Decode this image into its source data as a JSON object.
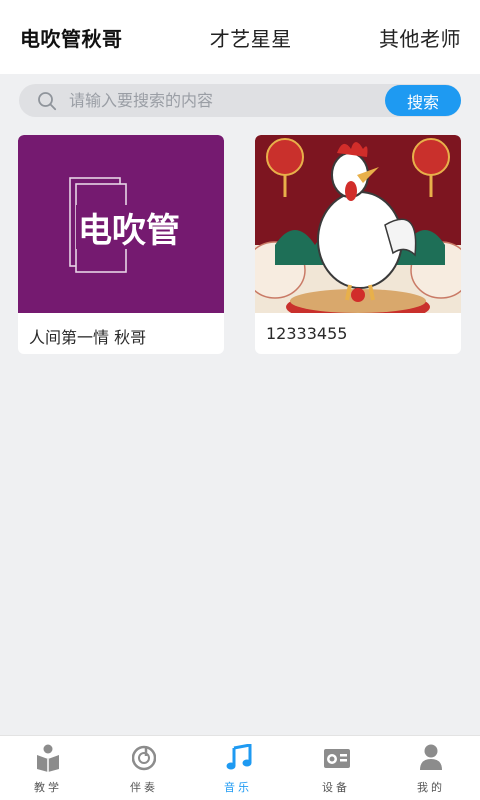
{
  "top_tabs": [
    {
      "label": "电吹管秋哥",
      "active": true
    },
    {
      "label": "才艺星星",
      "active": false
    },
    {
      "label": "其他老师",
      "active": false
    }
  ],
  "search": {
    "placeholder": "请输入要搜索的内容",
    "value": "",
    "button_label": "搜索"
  },
  "cards": [
    {
      "title": "人间第一情 秋哥",
      "image_text": "电吹管",
      "image_bg": "#751a70"
    },
    {
      "title": "12333455",
      "image_desc": "rooster illustration"
    }
  ],
  "bottom_nav": {
    "items": [
      {
        "label": "教学",
        "icon": "book-person-icon",
        "active": false
      },
      {
        "label": "伴奏",
        "icon": "disc-icon",
        "active": false
      },
      {
        "label": "音乐",
        "icon": "music-note-icon",
        "active": true
      },
      {
        "label": "设备",
        "icon": "radio-icon",
        "active": false
      },
      {
        "label": "我的",
        "icon": "person-icon",
        "active": false
      }
    ]
  },
  "colors": {
    "accent": "#1e9af2",
    "background": "#eff0f2",
    "icon_gray": "#8c8c8c"
  }
}
